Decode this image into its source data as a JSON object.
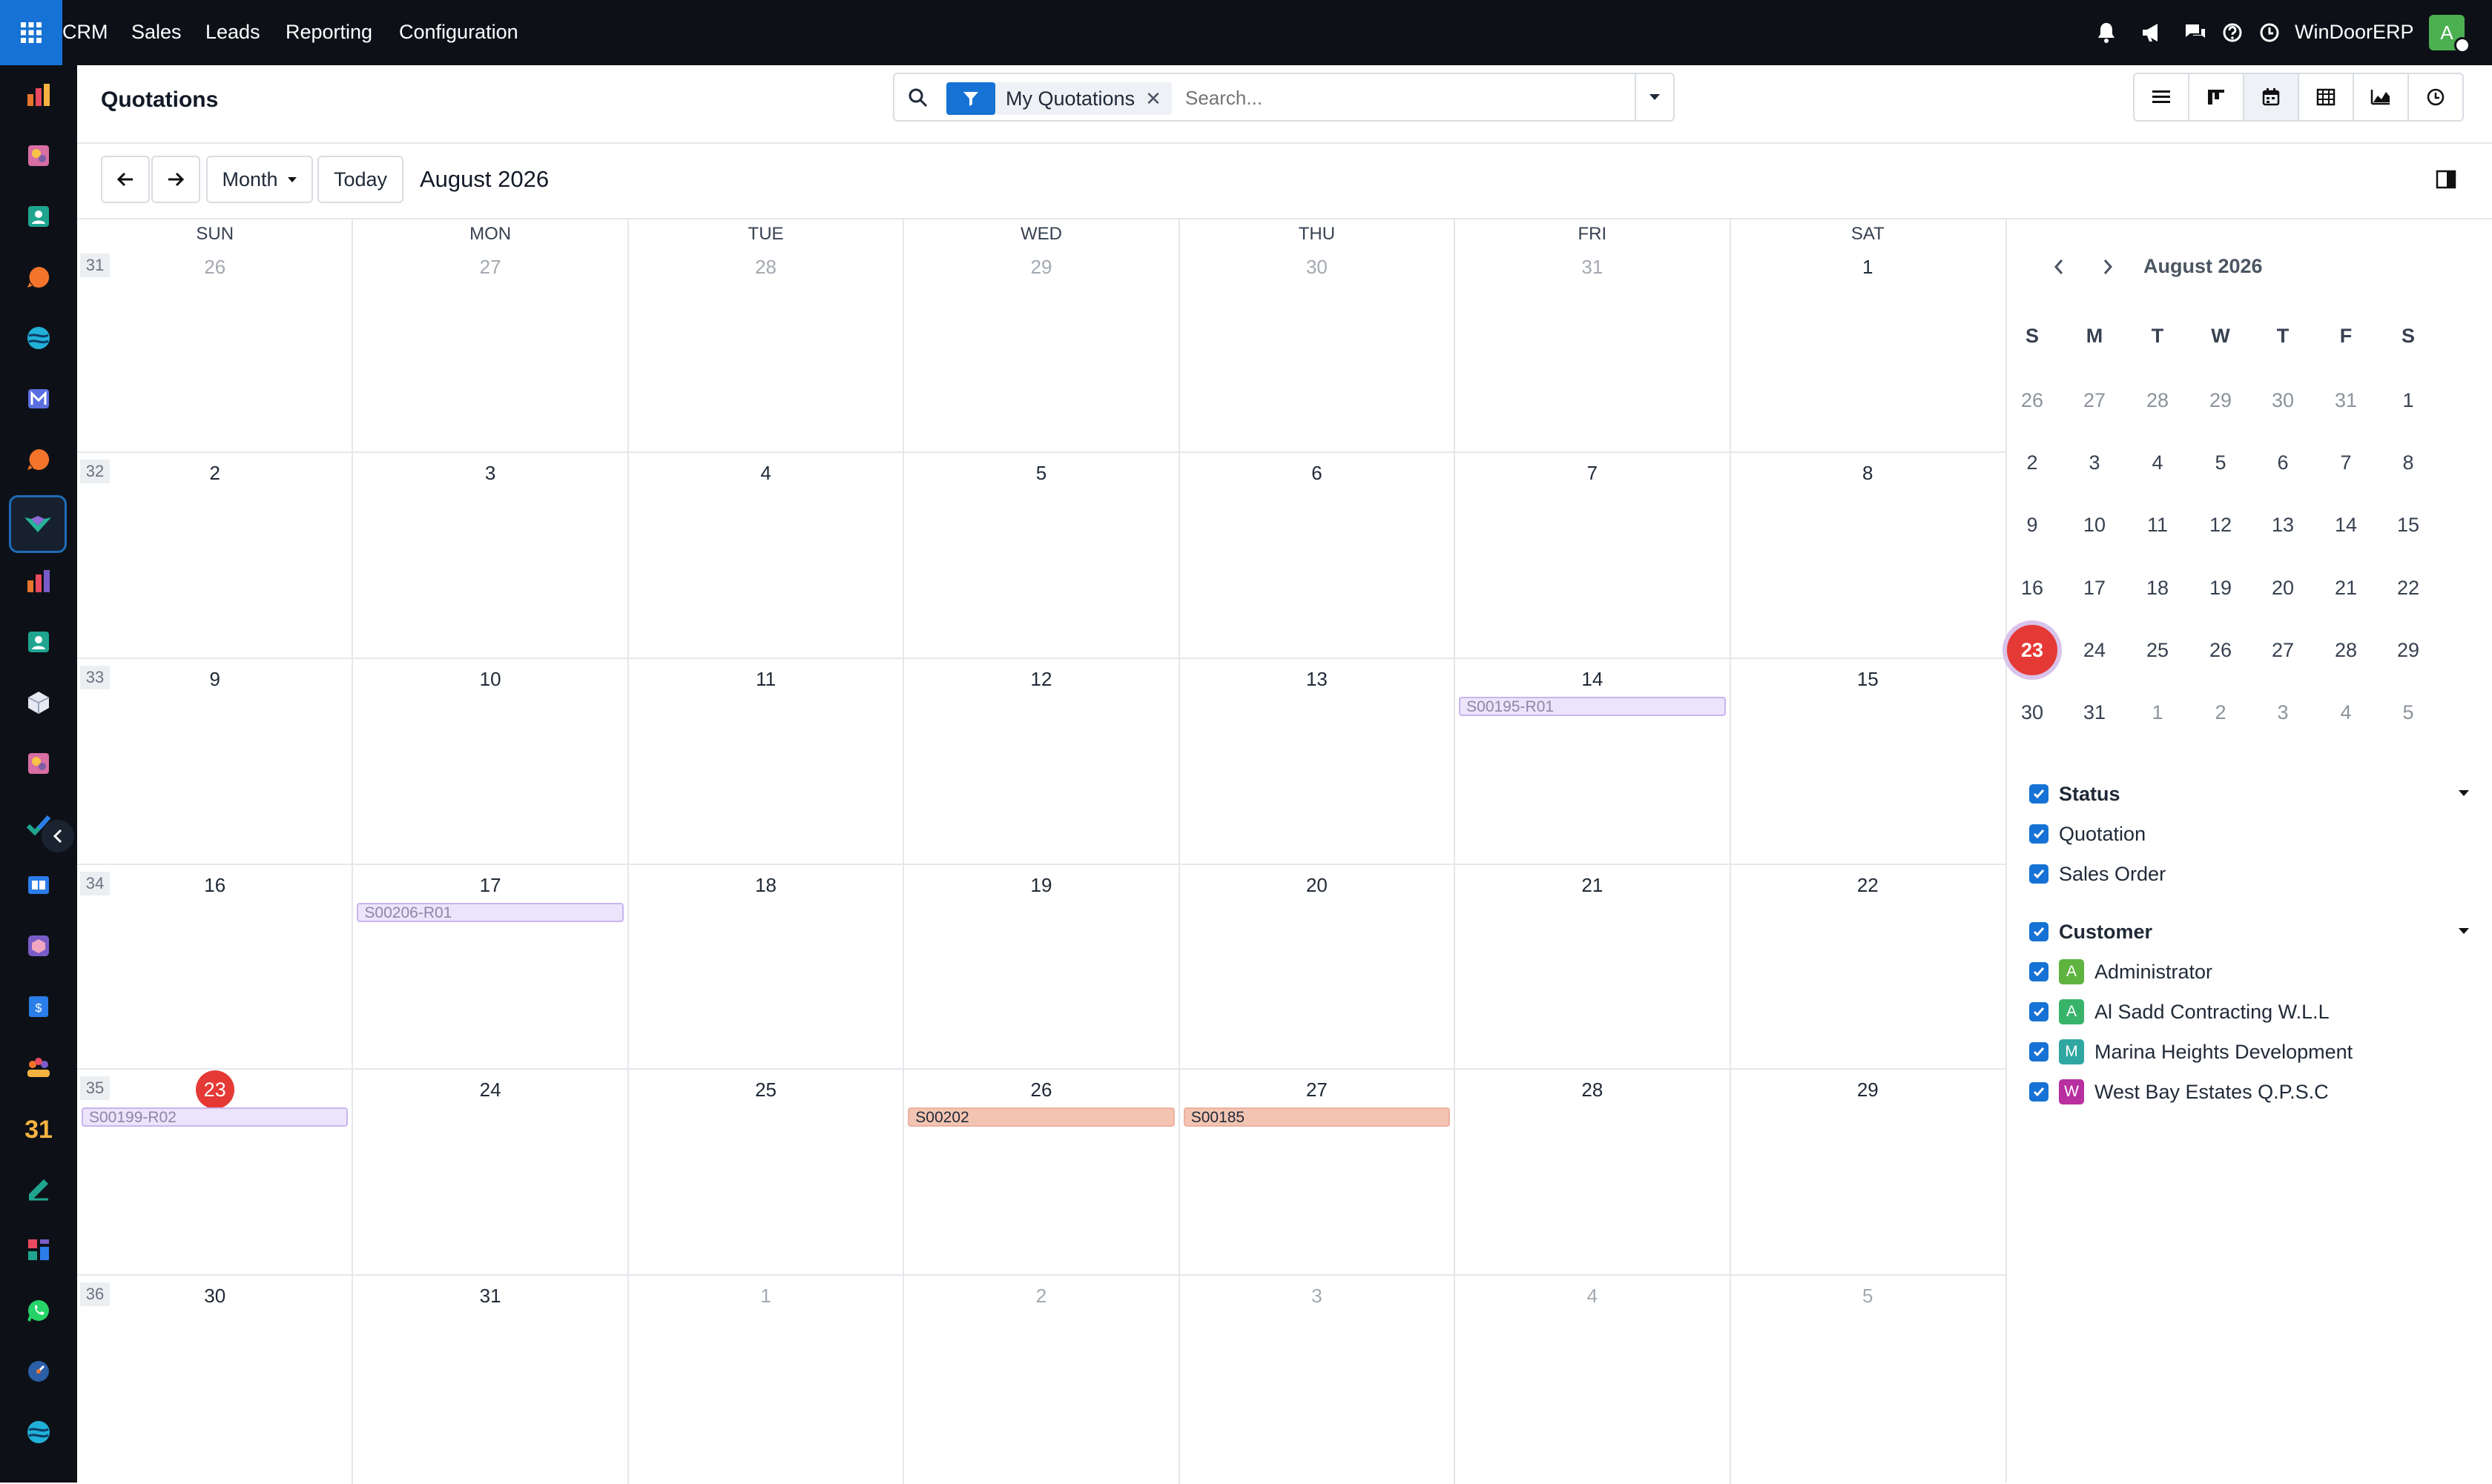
{
  "topbar": {
    "menus": [
      "CRM",
      "Sales",
      "Leads",
      "Reporting",
      "Configuration"
    ],
    "company": "WinDoorERP",
    "user_initial": "A"
  },
  "sidebar": {
    "apps": [
      "dashboard-app",
      "documents-app",
      "contacts-app",
      "discuss-app",
      "website-app",
      "mail-app",
      "chat-app",
      "crm-app",
      "sales-app",
      "employees-app",
      "inventory-app",
      "studio-app",
      "project-app",
      "knowledge-app",
      "purchase-app",
      "invoicing-app",
      "team-app",
      "calendar-app",
      "sign-app",
      "spreadsheet-app",
      "whatsapp-app",
      "timer-app",
      "website-builder-app"
    ],
    "active_app": "crm-app"
  },
  "control": {
    "breadcrumb": "Quotations",
    "facet": "My Quotations",
    "search_placeholder": "Search...",
    "views": [
      "list-view",
      "kanban-view",
      "calendar-view",
      "pivot-view",
      "graph-view",
      "activity-view"
    ],
    "active_view": "calendar-view"
  },
  "calendar": {
    "scale": "Month",
    "today_label": "Today",
    "period": "August 2026",
    "weekdays": [
      "SUN",
      "MON",
      "TUE",
      "WED",
      "THU",
      "FRI",
      "SAT"
    ],
    "weeks": [
      {
        "num": "31",
        "days": [
          {
            "d": "26",
            "o": true
          },
          {
            "d": "27",
            "o": true
          },
          {
            "d": "28",
            "o": true
          },
          {
            "d": "29",
            "o": true
          },
          {
            "d": "30",
            "o": true
          },
          {
            "d": "31",
            "o": true
          },
          {
            "d": "1",
            "o": false
          }
        ]
      },
      {
        "num": "32",
        "days": [
          {
            "d": "2",
            "o": false
          },
          {
            "d": "3",
            "o": false
          },
          {
            "d": "4",
            "o": false
          },
          {
            "d": "5",
            "o": false
          },
          {
            "d": "6",
            "o": false
          },
          {
            "d": "7",
            "o": false
          },
          {
            "d": "8",
            "o": false
          }
        ]
      },
      {
        "num": "33",
        "days": [
          {
            "d": "9",
            "o": false
          },
          {
            "d": "10",
            "o": false
          },
          {
            "d": "11",
            "o": false
          },
          {
            "d": "12",
            "o": false
          },
          {
            "d": "13",
            "o": false
          },
          {
            "d": "14",
            "o": false
          },
          {
            "d": "15",
            "o": false
          }
        ]
      },
      {
        "num": "34",
        "days": [
          {
            "d": "16",
            "o": false
          },
          {
            "d": "17",
            "o": false
          },
          {
            "d": "18",
            "o": false
          },
          {
            "d": "19",
            "o": false
          },
          {
            "d": "20",
            "o": false
          },
          {
            "d": "21",
            "o": false
          },
          {
            "d": "22",
            "o": false
          }
        ]
      },
      {
        "num": "35",
        "days": [
          {
            "d": "23",
            "o": false,
            "today": true
          },
          {
            "d": "24",
            "o": false
          },
          {
            "d": "25",
            "o": false
          },
          {
            "d": "26",
            "o": false
          },
          {
            "d": "27",
            "o": false
          },
          {
            "d": "28",
            "o": false
          },
          {
            "d": "29",
            "o": false
          }
        ]
      },
      {
        "num": "36",
        "days": [
          {
            "d": "30",
            "o": false
          },
          {
            "d": "31",
            "o": false
          },
          {
            "d": "1",
            "o": true
          },
          {
            "d": "2",
            "o": true
          },
          {
            "d": "3",
            "o": true
          },
          {
            "d": "4",
            "o": true
          },
          {
            "d": "5",
            "o": true
          }
        ]
      }
    ],
    "events": [
      {
        "label": "S00195-R01",
        "week": 2,
        "day": 5,
        "status": "Quotation",
        "color": "#ece4fb"
      },
      {
        "label": "S00206-R01",
        "week": 3,
        "day": 1,
        "status": "Quotation",
        "color": "#ece4fb"
      },
      {
        "label": "S00199-R02",
        "week": 4,
        "day": 0,
        "status": "Quotation",
        "color": "#ece4fb"
      },
      {
        "label": "S00202",
        "week": 4,
        "day": 3,
        "status": "Sales Order",
        "color": "#f3c4b2"
      },
      {
        "label": "S00185",
        "week": 4,
        "day": 4,
        "status": "Sales Order",
        "color": "#f3c4b2"
      }
    ]
  },
  "mini_calendar": {
    "title": "August 2026",
    "weekdays": [
      "S",
      "M",
      "T",
      "W",
      "T",
      "F",
      "S"
    ],
    "weeks": [
      [
        {
          "d": "26",
          "o": true
        },
        {
          "d": "27",
          "o": true
        },
        {
          "d": "28",
          "o": true
        },
        {
          "d": "29",
          "o": true
        },
        {
          "d": "30",
          "o": true
        },
        {
          "d": "31",
          "o": true
        },
        {
          "d": "1",
          "o": false
        }
      ],
      [
        {
          "d": "2",
          "o": false
        },
        {
          "d": "3",
          "o": false
        },
        {
          "d": "4",
          "o": false
        },
        {
          "d": "5",
          "o": false
        },
        {
          "d": "6",
          "o": false
        },
        {
          "d": "7",
          "o": false
        },
        {
          "d": "8",
          "o": false
        }
      ],
      [
        {
          "d": "9",
          "o": false
        },
        {
          "d": "10",
          "o": false
        },
        {
          "d": "11",
          "o": false
        },
        {
          "d": "12",
          "o": false
        },
        {
          "d": "13",
          "o": false
        },
        {
          "d": "14",
          "o": false
        },
        {
          "d": "15",
          "o": false
        }
      ],
      [
        {
          "d": "16",
          "o": false
        },
        {
          "d": "17",
          "o": false
        },
        {
          "d": "18",
          "o": false
        },
        {
          "d": "19",
          "o": false
        },
        {
          "d": "20",
          "o": false
        },
        {
          "d": "21",
          "o": false
        },
        {
          "d": "22",
          "o": false
        }
      ],
      [
        {
          "d": "23",
          "o": false,
          "today": true
        },
        {
          "d": "24",
          "o": false
        },
        {
          "d": "25",
          "o": false
        },
        {
          "d": "26",
          "o": false
        },
        {
          "d": "27",
          "o": false
        },
        {
          "d": "28",
          "o": false
        },
        {
          "d": "29",
          "o": false
        }
      ],
      [
        {
          "d": "30",
          "o": false
        },
        {
          "d": "31",
          "o": false
        },
        {
          "d": "1",
          "o": true
        },
        {
          "d": "2",
          "o": true
        },
        {
          "d": "3",
          "o": true
        },
        {
          "d": "4",
          "o": true
        },
        {
          "d": "5",
          "o": true
        }
      ]
    ]
  },
  "filters": {
    "status": {
      "title": "Status",
      "items": [
        "Quotation",
        "Sales Order"
      ]
    },
    "customer": {
      "title": "Customer",
      "items": [
        {
          "initial": "A",
          "name": "Administrator",
          "color": "#5fb33f"
        },
        {
          "initial": "A",
          "name": "Al Sadd Contracting W.L.L",
          "color": "#37b36a"
        },
        {
          "initial": "M",
          "name": "Marina Heights Development",
          "color": "#2fa7a0"
        },
        {
          "initial": "W",
          "name": "West Bay Estates Q.P.S.C",
          "color": "#b82fa0"
        }
      ]
    }
  },
  "colors": {
    "topbar": "#0d1117",
    "accent": "#1672d4",
    "today": "#e53935",
    "quotation_event": "#ece4fb",
    "sales_order_event": "#f3c4b2"
  }
}
